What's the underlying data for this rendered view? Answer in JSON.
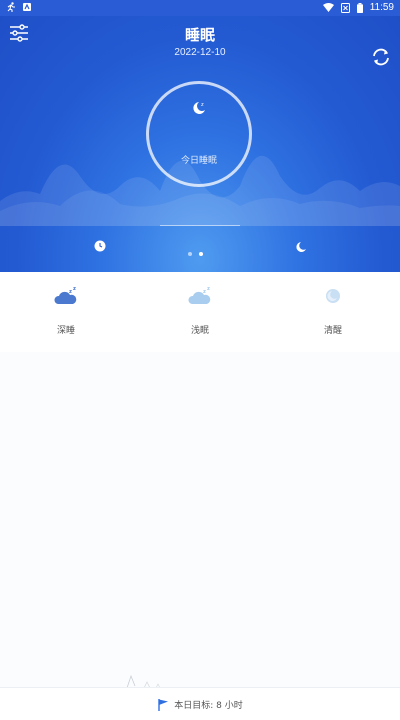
{
  "status_bar": {
    "time": "11:59",
    "left_icons": [
      "running-icon",
      "app-notification-icon"
    ],
    "right_icons": [
      "wifi-icon",
      "no-sim-icon",
      "battery-icon"
    ]
  },
  "header": {
    "title": "睡眠",
    "date": "2022-12-10",
    "ring_label": "今日睡眠"
  },
  "pager": {
    "pages": 2,
    "active_index": 1
  },
  "legend": [
    {
      "label": "深睡",
      "icon": "deep-sleep-cloud-icon",
      "color": "#4a79cf"
    },
    {
      "label": "浅眠",
      "icon": "light-sleep-cloud-icon",
      "color": "#a9cdef"
    },
    {
      "label": "清醒",
      "icon": "awake-moon-icon",
      "color": "#c9dff3"
    }
  ],
  "footer": {
    "goal_text": "本日目标: 8 小时"
  },
  "colors": {
    "hero_dark": "#1f4fc8",
    "hero_light": "#4f9bf0",
    "deep_sleep": "#4a79cf",
    "light_sleep": "#a9cdef",
    "awake": "#c9dff3",
    "flag": "#2f6fe0"
  }
}
